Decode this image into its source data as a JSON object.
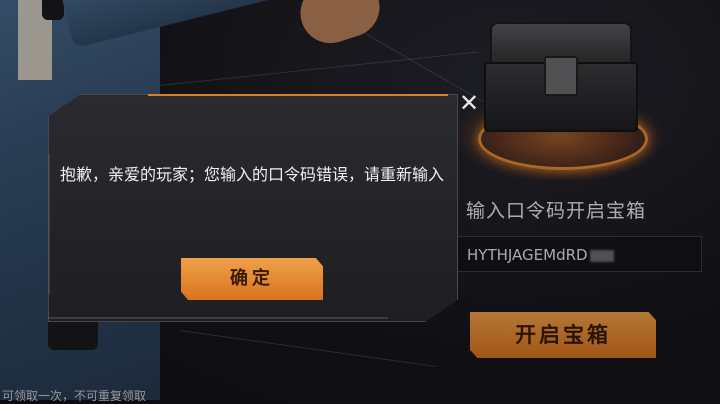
{
  "redeem": {
    "title": "输入口令码开启宝箱",
    "code_value": "HYTHJAGEMdRD",
    "open_button": "开启宝箱",
    "note": "可领取一次，不可重复领取"
  },
  "dialog": {
    "message": "抱歉，亲爱的玩家；您输入的口令码错误，请重新输入",
    "confirm_button": "确定",
    "close_icon": "close-icon"
  },
  "colors": {
    "accent": "#e88a2e",
    "panel": "#232328",
    "text": "#f0f0f2"
  }
}
